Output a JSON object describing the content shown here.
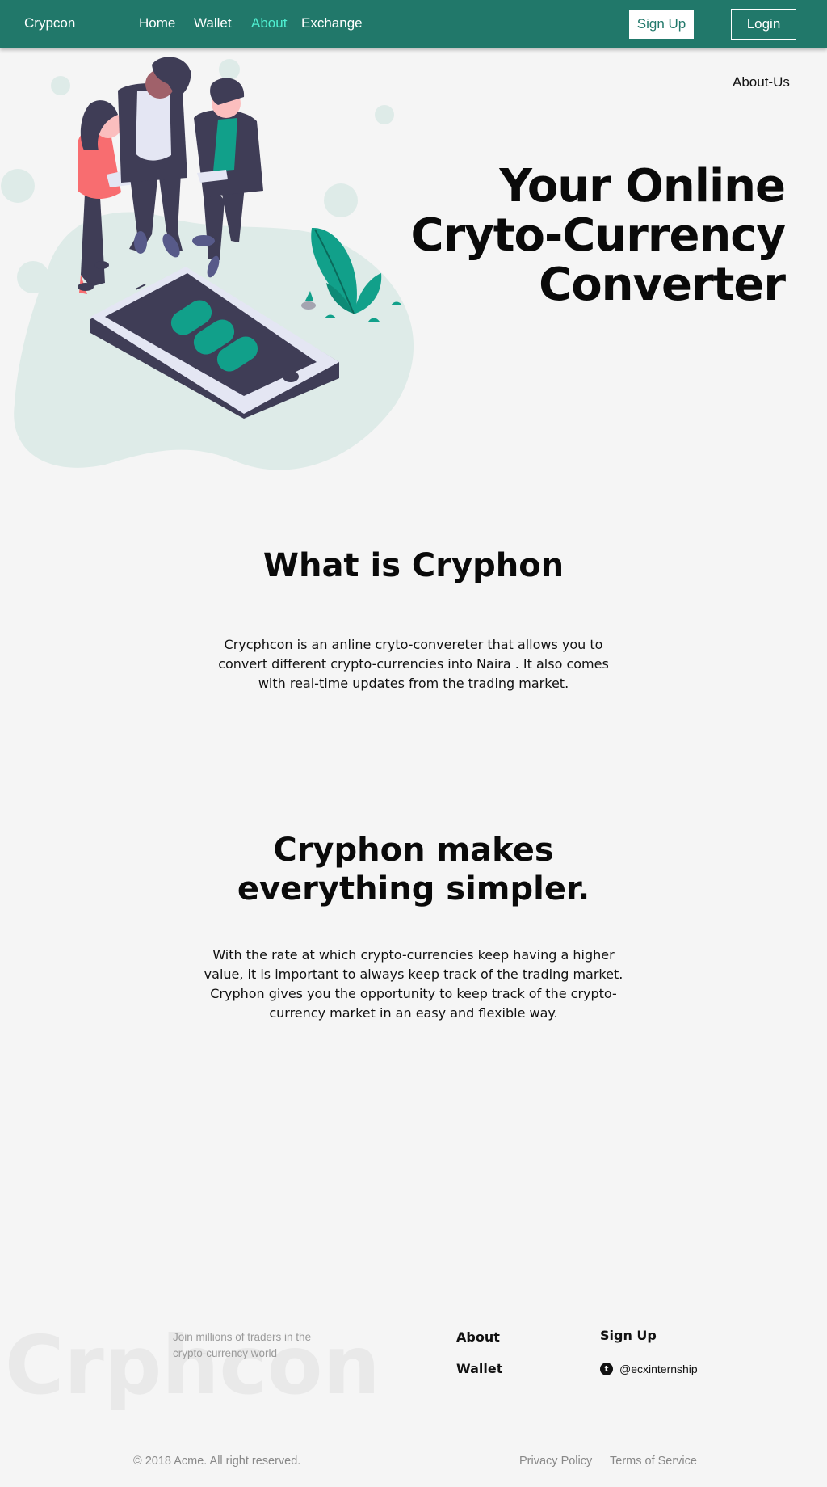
{
  "navbar": {
    "brand": "Crypcon",
    "links": [
      {
        "label": "Home",
        "active": false
      },
      {
        "label": "Wallet",
        "active": false
      },
      {
        "label": "About",
        "active": true
      },
      {
        "label": "Exchange",
        "active": false
      }
    ],
    "signup_label": "Sign Up",
    "login_label": "Login"
  },
  "hero": {
    "about_us_link": "About-Us",
    "title_lines": [
      "Your Online",
      "Cryto-Currency",
      "Converter"
    ]
  },
  "what_section": {
    "title": "What is Cryphon",
    "text": "Crycphcon is an anline cryto-convereter that allows you to convert different crypto-currencies into Naira . It also comes with real-time updates from the trading market."
  },
  "simpler_section": {
    "title": "Cryphon makes everything simpler.",
    "text": "With the rate at which crypto-currencies keep having a higher value, it is important to always keep track of the trading market. Cryphon gives you the opportunity to keep track of the crypto-currency market in an easy and flexible way."
  },
  "footer": {
    "watermark": "Crphcon",
    "tagline": "Join millions of traders in the crypto-currency world",
    "links": {
      "about": "About",
      "wallet": "Wallet",
      "signup": "Sign Up"
    },
    "social": {
      "icon": "twitter-icon",
      "handle": "@ecxinternship"
    },
    "copyright": "© 2018 Acme. All right reserved.",
    "legal": {
      "privacy": "Privacy Policy",
      "terms": "Terms of Service"
    }
  },
  "colors": {
    "nav_bg": "#21786a",
    "nav_active": "#4ff0d1",
    "accent": "#11a08a",
    "blob": "#deebe8",
    "dark_figure": "#3f3d56",
    "coral": "#f86d70"
  }
}
